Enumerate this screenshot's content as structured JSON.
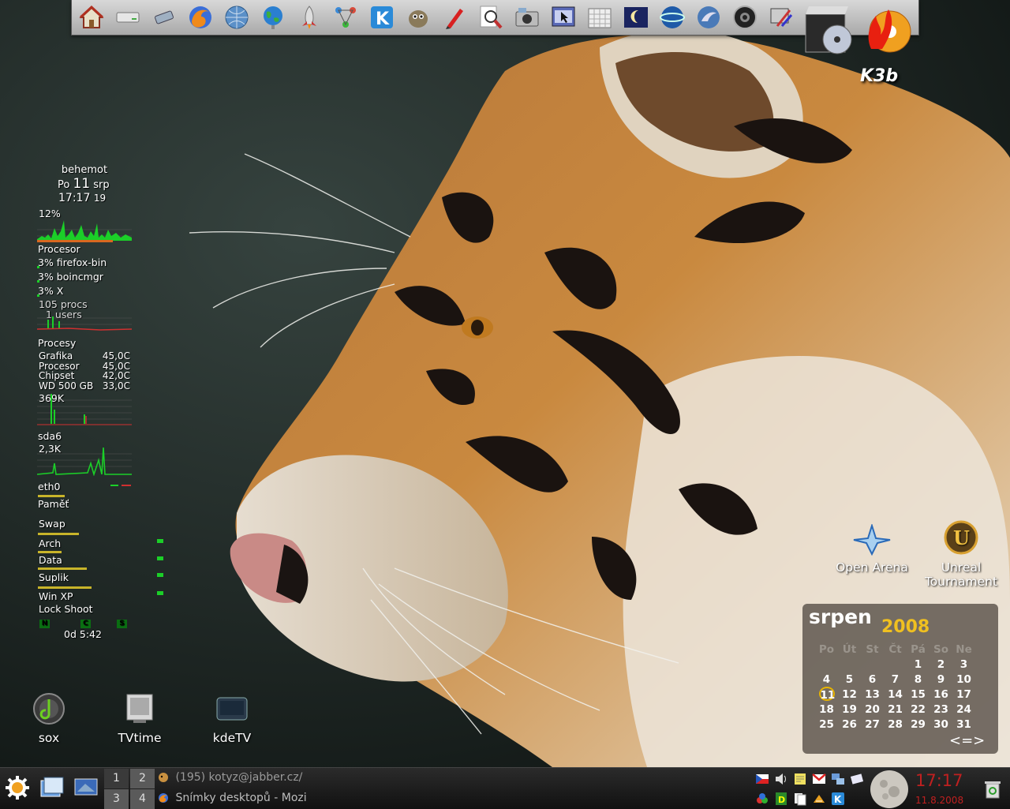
{
  "launcher": {
    "icons": [
      "home-icon",
      "drive-icon",
      "usb-icon",
      "firefox-icon",
      "globe-icon",
      "earth-icon",
      "rocket-icon",
      "network-icon",
      "kde-icon",
      "gimp-icon",
      "pen-icon",
      "search-icon",
      "camera-icon",
      "screenshot-icon",
      "calendar-icon",
      "moon-icon",
      "stellarium-icon",
      "dolphin-icon",
      "disc-icon",
      "film-tools-icon"
    ],
    "k3b_label": "K3b"
  },
  "monitor": {
    "hostname": "behemot",
    "day": "Po",
    "date_num": "11",
    "month": "srp",
    "time": "17:17",
    "seconds": "19",
    "cpu_percent": "12%",
    "cpu_label": "Procesor",
    "top_procs": [
      "3% firefox-bin",
      "3% boincmgr",
      "3% X"
    ],
    "procs": "105 procs",
    "users": "1 users",
    "procs_label": "Procesy",
    "sensors": [
      {
        "name": "Grafika",
        "value": "45,0C"
      },
      {
        "name": "Procesor",
        "value": "45,0C"
      },
      {
        "name": "Chipset",
        "value": "42,0C"
      },
      {
        "name": "WD 500 GB",
        "value": "33,0C"
      }
    ],
    "net_rate": "369K",
    "disk_label": "sda6",
    "disk_rate": "2,3K",
    "eth_label": "eth0",
    "mem_label": "Paměť",
    "swap_label": "Swap",
    "mounts": [
      "Arch",
      "Data",
      "Suplik",
      "Win XP"
    ],
    "lock": "Lock",
    "shoot": "Shoot",
    "indicators": [
      "N",
      "C",
      "S"
    ],
    "uptime": "0d  5:42"
  },
  "desktop_icons": {
    "sox": "sox",
    "tvtime": "TVtime",
    "kdetv": "kdeTV",
    "openarena": "Open Arena",
    "unreal": "Unreal Tournament"
  },
  "calendar": {
    "month": "srpen",
    "year": "2008",
    "weekdays": [
      "Po",
      "Út",
      "St",
      "Čt",
      "Pá",
      "So",
      "Ne"
    ],
    "weeks": [
      [
        "",
        "",
        "",
        "",
        "1",
        "2",
        "3"
      ],
      [
        "4",
        "5",
        "6",
        "7",
        "8",
        "9",
        "10"
      ],
      [
        "11",
        "12",
        "13",
        "14",
        "15",
        "16",
        "17"
      ],
      [
        "18",
        "19",
        "20",
        "21",
        "22",
        "23",
        "24"
      ],
      [
        "25",
        "26",
        "27",
        "28",
        "29",
        "30",
        "31"
      ]
    ],
    "today": "11",
    "nav": "<=>"
  },
  "taskbar": {
    "pager": [
      "1",
      "2",
      "3",
      "4"
    ],
    "tasks": [
      "(195) kotyz@jabber.cz/",
      "Snímky desktopů - Mozi"
    ],
    "clock_time": "17:17",
    "clock_date": "11.8.2008"
  },
  "colors": {
    "graph_green": "#1bcf28",
    "calendar_year": "#f0c020",
    "clock_red": "#c02020",
    "today_ring": "#e8b400"
  }
}
